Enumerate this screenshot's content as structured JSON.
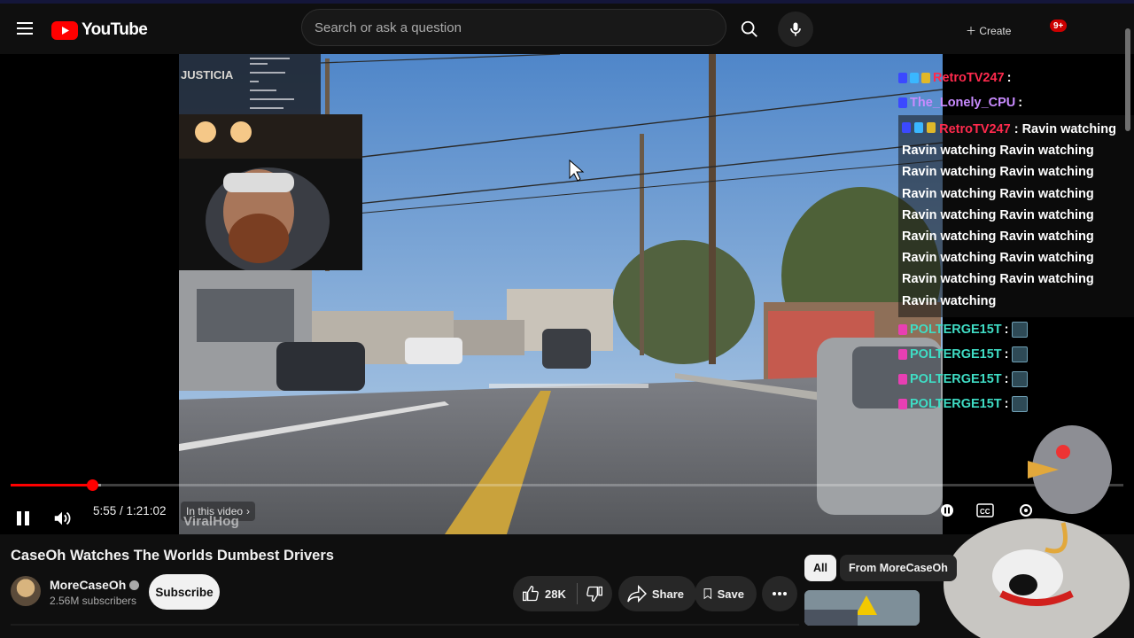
{
  "header": {
    "logo_text": "YouTube",
    "search_placeholder": "Search or ask a question",
    "create_label": "Create",
    "notification_count": "9+"
  },
  "chat_overlay": {
    "lines": [
      {
        "user": "RetroTV247",
        "user_color": "#ff2a4d",
        "text": ""
      },
      {
        "user": "The_Lonely_CPU",
        "user_color": "#c98bff",
        "text": ""
      }
    ],
    "highlight": {
      "user": "RetroTV247",
      "user_color": "#ff2a4d",
      "text": "Ravin watching Ravin watching Ravin watching Ravin watching Ravin watching Ravin watching Ravin watching Ravin watching Ravin watching Ravin watching Ravin watching Ravin watching Ravin watching Ravin watching Ravin watching Ravin watching"
    },
    "repeat_user": "POLTERGE15T",
    "repeat_color": "#3fdcc4",
    "repeat_count": 4
  },
  "player": {
    "time_current": "5:55",
    "time_total": "1:21:02",
    "time_display": "5:55 / 1:21:02",
    "in_video_label": "In this video",
    "watermark": "ViralHog",
    "progress_fraction": 0.073,
    "buffer_fraction": 0.081,
    "accent_color": "#ff0000"
  },
  "video": {
    "title": "CaseOh Watches The Worlds Dumbest Drivers",
    "channel": "MoreCaseOh",
    "subscribers": "2.56M subscribers",
    "subscribe_label": "Subscribe",
    "likes": "28K",
    "share_label": "Share",
    "save_label": "Save"
  },
  "related": {
    "chips": [
      "All",
      "From MoreCaseOh"
    ]
  }
}
